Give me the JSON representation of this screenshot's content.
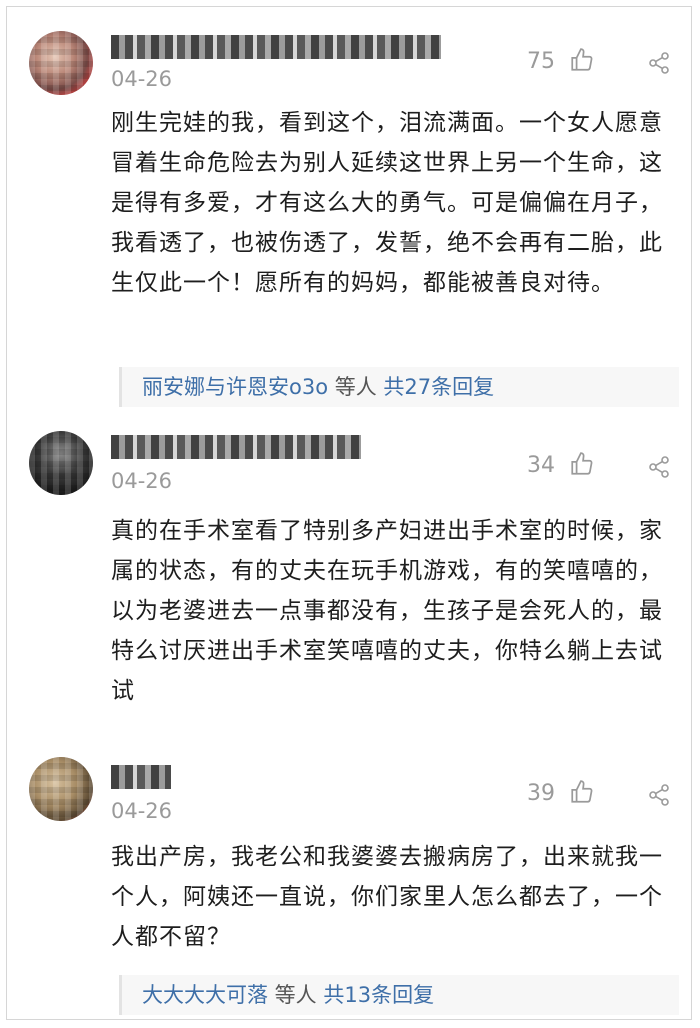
{
  "comments": [
    {
      "date": "04-26",
      "likes": "75",
      "text": "刚生完娃的我，看到这个，泪流满面。一个女人愿意冒着生命危险去为别人延续这世界上另一个生命，这是得有多爱，才有这么大的勇气。可是偏偏在月子，我看透了，也被伤透了，发誓，绝不会再有二胎，此生仅此一个！愿所有的妈妈，都能被善良对待。",
      "replies": {
        "names": "丽安娜与许恩安o3o",
        "mid": " 等人 ",
        "count": "共27条回复"
      }
    },
    {
      "date": "04-26",
      "likes": "34",
      "text": "真的在手术室看了特别多产妇进出手术室的时候，家属的状态，有的丈夫在玩手机游戏，有的笑嘻嘻的，以为老婆进去一点事都没有，生孩子是会死人的，最特么讨厌进出手术室笑嘻嘻的丈夫，你特么躺上去试试"
    },
    {
      "date": "04-26",
      "likes": "39",
      "text": "我出产房，我老公和我婆婆去搬病房了，出来就我一个人，阿姨还一直说，你们家里人怎么都去了，一个人都不留？",
      "replies": {
        "names": "大大大大可落",
        "mid": " 等人 ",
        "count": "共13条回复"
      }
    }
  ],
  "icons": {
    "like": "thumbs-up-icon",
    "share": "share-icon"
  },
  "colors": {
    "meta": "#9a9a9a",
    "link": "#3e6fa8",
    "text": "#1e1e1e"
  }
}
